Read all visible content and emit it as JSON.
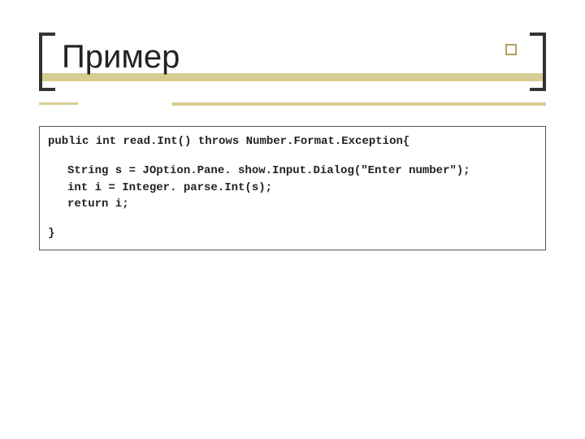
{
  "title": "Пример",
  "code": {
    "line1": "public int read.Int() throws Number.Format.Exception{",
    "line2": "String s = JOption.Pane. show.Input.Dialog(\"Enter number\");",
    "line3": "int i = Integer. parse.Int(s);",
    "line4": "return i;",
    "line5": "}"
  }
}
